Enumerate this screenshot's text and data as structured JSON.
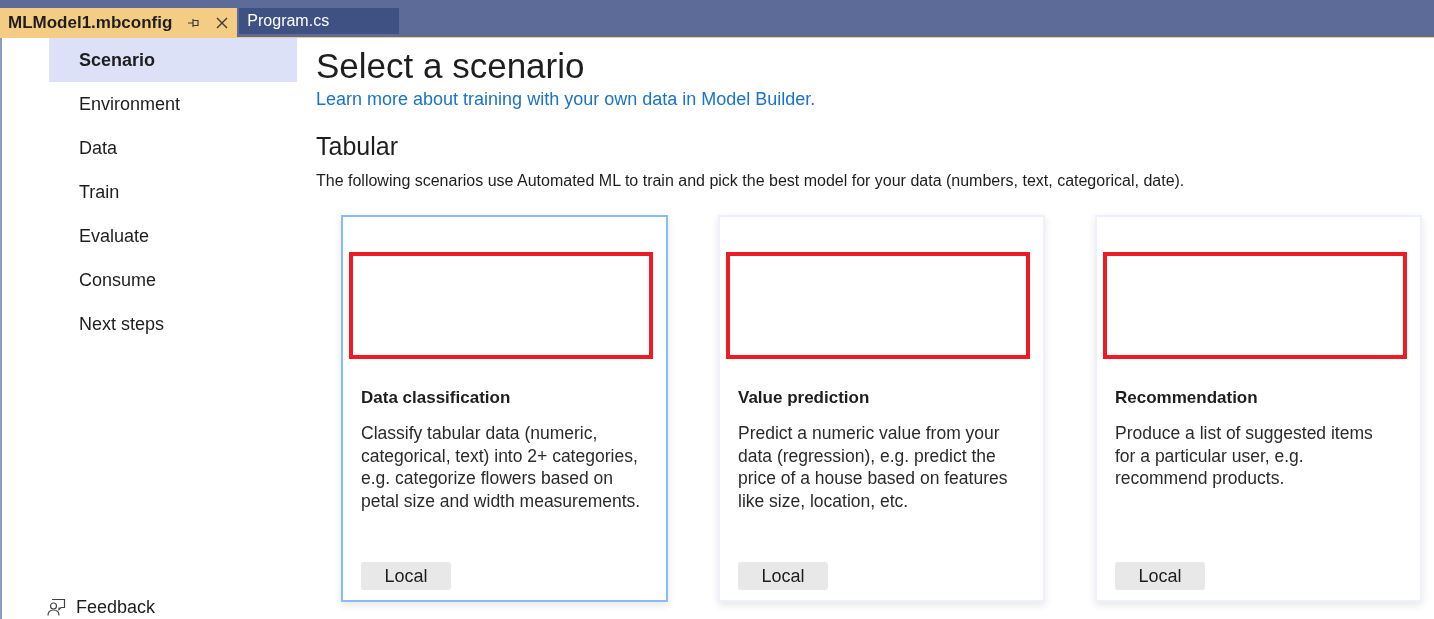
{
  "tabs": [
    {
      "label": "MLModel1.mbconfig",
      "selected": true
    },
    {
      "label": "Program.cs",
      "selected": false
    }
  ],
  "sidebar": {
    "items": [
      {
        "label": "Scenario",
        "selected": true
      },
      {
        "label": "Environment",
        "selected": false
      },
      {
        "label": "Data",
        "selected": false
      },
      {
        "label": "Train",
        "selected": false
      },
      {
        "label": "Evaluate",
        "selected": false
      },
      {
        "label": "Consume",
        "selected": false
      },
      {
        "label": "Next steps",
        "selected": false
      }
    ],
    "feedback": "Feedback"
  },
  "main": {
    "title": "Select a scenario",
    "link": "Learn more about training with your own data in Model Builder.",
    "section": {
      "title": "Tabular",
      "description": "The following scenarios use Automated ML to train and pick the best model for your data (numbers, text, categorical, date).",
      "cards": [
        {
          "title": "Data classification",
          "description": "Classify tabular data (numeric, categorical, text) into 2+ categories, e.g. categorize flowers based on petal size and width measurements.",
          "button": "Local",
          "selected": true
        },
        {
          "title": "Value prediction",
          "description": "Predict a numeric value from your data (regression), e.g. predict the price of a house based on features like size, location, etc.",
          "button": "Local",
          "selected": false
        },
        {
          "title": "Recommendation",
          "description": "Produce a list of suggested items for a particular user, e.g. recommend products.",
          "button": "Local",
          "selected": false
        }
      ]
    }
  }
}
